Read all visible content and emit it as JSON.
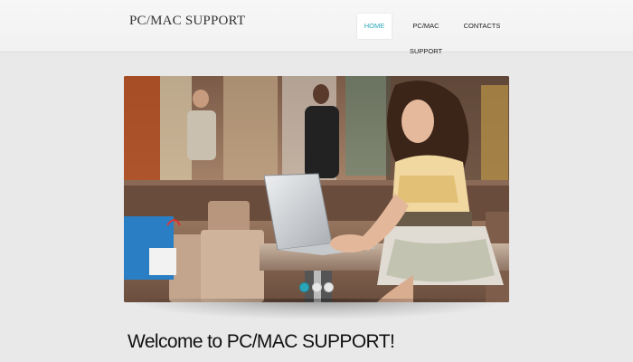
{
  "header": {
    "logo": "PC/MAC SUPPORT",
    "nav": [
      {
        "label": "HOME",
        "active": true
      },
      {
        "label": "PC/MAC SUPPORT",
        "active": false
      },
      {
        "label": "CONTACTS",
        "active": false
      }
    ]
  },
  "slider": {
    "active_slide": 1,
    "slide_count": 3
  },
  "main": {
    "welcome": "Welcome to PC/MAC SUPPORT!"
  },
  "colors": {
    "accent": "#2aa6b9",
    "background": "#e9e9e9"
  }
}
